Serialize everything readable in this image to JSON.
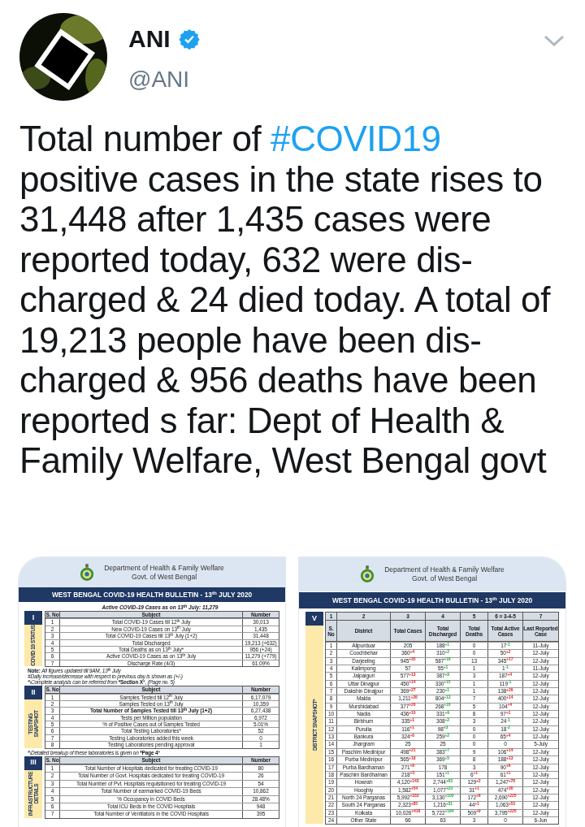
{
  "tweet": {
    "author": {
      "name": "ANI",
      "handle": "@ANI",
      "verified": true
    },
    "text": [
      {
        "kind": "text",
        "value": "Total number of "
      },
      {
        "kind": "hashtag",
        "value": "#COVID19"
      },
      {
        "kind": "text",
        "value": " positive cases in the state rises to 31,448 after 1,435 cases were reported today, 632 were dis-charged & 24 died today. A total of 19,213 people have been dis-charged & 956 deaths have been reported s far: Dept of Health & Family Welfare, West Bengal govt"
      }
    ]
  },
  "images": [
    {
      "kind": "status_sheet",
      "department": "Department of Health & Family Welfare",
      "government": "Govt. of West Bengal",
      "banner": "WEST BENGAL COVID-19 HEALTH BULLETIN -  13$^{th}$ JULY 2020",
      "headline": "Active COVID-19 Cases as on 13$^{th}$ July: 11,279",
      "sections": [
        {
          "numeral": "I",
          "label": "COVID 19 STATUS",
          "columns": [
            "S. No",
            "Subject",
            "Number"
          ],
          "rows": [
            [
              "1",
              "Total COVID-19 Cases till 12$^{th}$ July",
              "30,013"
            ],
            [
              "2",
              "New COVID-19 Cases on 13$^{th}$ July",
              "1,435"
            ],
            [
              "3",
              "Total COVID-19 Cases till 13$^{th}$ July (1+2)",
              "31,448"
            ],
            [
              "4",
              "Total Discharged",
              "19,213 (+632)"
            ],
            [
              "5",
              "Total Deaths as on 13$^{th}$ July*",
              "956 (+24)"
            ],
            [
              "6",
              "Active COVID-19 Cases as on 13$^{th}$ July",
              "11,279 (+779)"
            ],
            [
              "7",
              "Discharge Rate (4/3)",
              "61.09%"
            ]
          ],
          "notes": [
            "**Note:** *All figures updated till 9AM, 13$^{th}$ July*",
            "*#Daily increase/decrease with respect to previous day is shown as (+/-)*",
            "*\\*Complete analysis can be referred from* ***Section X***, *(Page no. 5)*"
          ]
        },
        {
          "numeral": "II",
          "label": "TESTING SNAPSHOT",
          "columns": [
            "S. No",
            "Subject",
            "Number"
          ],
          "rows": [
            [
              "1",
              "Samples Tested till 12$^{th}$ July",
              "6,17,079"
            ],
            [
              "2",
              "Samples Tested on 13$^{th}$ July",
              "10,359"
            ],
            [
              "3",
              "**Total Number of Samples Tested till 13$^{th}$ July (1+2)**",
              "6,27,438"
            ],
            [
              "4",
              "Tests per Million population",
              "6,972"
            ],
            [
              "5",
              "% of Positive Cases out of Samples Tested",
              "5.01%"
            ],
            [
              "6",
              "Total Testing Laboratories*",
              "52"
            ],
            [
              "7",
              "Testing Laboratories added this week",
              "0"
            ],
            [
              "8",
              "Testing Laboratories pending approval",
              "1"
            ]
          ],
          "notes": [
            "*\\*Detailed breakup of these laboratories is given on* ***Page 4***"
          ]
        },
        {
          "numeral": "III",
          "label": "INFRASTRUCTURE DETAILS",
          "columns": [
            "S. No",
            "Subject",
            "Number"
          ],
          "rows": [
            [
              "1",
              "Total Number of Hospitals dedicated for treating COVID-19",
              "80"
            ],
            [
              "2",
              "Total Number of Govt. Hospitals dedicated for treating COVID-19",
              "26"
            ],
            [
              "3",
              "Total Number of Pvt. Hospitals requisitioned for treating COVID-19",
              "54"
            ],
            [
              "4",
              "Total Number of earmarked COVID-19 Beds",
              "10,862"
            ],
            [
              "5",
              "% Occupancy in COVID Beds",
              "28.48%"
            ],
            [
              "6",
              "Total ICU Beds in the COVID Hospitals",
              "948"
            ],
            [
              "7",
              "Total Number of Ventilators in the COVID Hospitals",
              "395"
            ]
          ]
        }
      ]
    },
    {
      "kind": "district_sheet",
      "department": "Department of Health & Family Welfare",
      "government": "Govt. of West Bengal",
      "banner": "WEST BENGAL COVID-19 HEALTH BULLETIN -  13$^{th}$ JULY 2020",
      "section": {
        "numeral": "V",
        "label": "DISTRICT SNAPSHOT*",
        "column_numbers": [
          "1",
          "2",
          "3",
          "4",
          "5",
          "6 = 3-4-5",
          "7"
        ],
        "columns": [
          "S. No",
          "District",
          "Total Cases",
          "Total Discharged",
          "Total Deaths",
          "Total Active Cases",
          "Last Reported Case"
        ],
        "rows": [
          {
            "sno": "1",
            "district": "Alipurduar",
            "cases": "205",
            "cases_change": "",
            "discharged": "188",
            "discharged_change": "+1",
            "deaths": "0",
            "deaths_change": "",
            "active": "17",
            "active_change": "-1",
            "active_down": true,
            "last_case": "11-July"
          },
          {
            "sno": "2",
            "district": "Coochbehar",
            "cases": "360",
            "cases_change": "+4",
            "discharged": "310",
            "discharged_change": "+2",
            "deaths": "0",
            "deaths_change": "",
            "active": "50",
            "active_change": "+2",
            "active_down": false,
            "last_case": "12-July"
          },
          {
            "sno": "3",
            "district": "Darjeeling",
            "cases": "945",
            "cases_change": "+35",
            "discharged": "587",
            "discharged_change": "+18",
            "deaths": "13",
            "deaths_change": "",
            "active": "345",
            "active_change": "+17",
            "active_down": false,
            "last_case": "12-July"
          },
          {
            "sno": "4",
            "district": "Kalimpong",
            "cases": "57",
            "cases_change": "",
            "discharged": "55",
            "discharged_change": "+1",
            "deaths": "1",
            "deaths_change": "",
            "active": "1",
            "active_change": "-1",
            "active_down": true,
            "last_case": "11-July"
          },
          {
            "sno": "5",
            "district": "Jalpaiguri",
            "cases": "577",
            "cases_change": "+13",
            "discharged": "387",
            "discharged_change": "+9",
            "deaths": "3",
            "deaths_change": "",
            "active": "187",
            "active_change": "+4",
            "active_down": false,
            "last_case": "12-July"
          },
          {
            "sno": "6",
            "district": "Uttar Dinajpur",
            "cases": "450",
            "cases_change": "+14",
            "discharged": "330",
            "discharged_change": "+15",
            "deaths": "1",
            "deaths_change": "",
            "active": "119",
            "active_change": "-1",
            "active_down": true,
            "last_case": "12-July"
          },
          {
            "sno": "7",
            "district": "Dakshin Dinajpur",
            "cases": "369",
            "cases_change": "+27",
            "discharged": "230",
            "discharged_change": "+1",
            "deaths": "1",
            "deaths_change": "",
            "active": "138",
            "active_change": "+26",
            "active_down": false,
            "last_case": "12-July"
          },
          {
            "sno": "8",
            "district": "Malda",
            "cases": "1,211",
            "cases_change": "+26",
            "discharged": "804",
            "discharged_change": "+12",
            "deaths": "7",
            "deaths_change": "",
            "active": "400",
            "active_change": "+14",
            "active_down": false,
            "last_case": "12-July"
          },
          {
            "sno": "9",
            "district": "Murshidabad",
            "cases": "377",
            "cases_change": "+20",
            "discharged": "268",
            "discharged_change": "+16",
            "deaths": "5",
            "deaths_change": "",
            "active": "104",
            "active_change": "+4",
            "active_down": false,
            "last_case": "12-July"
          },
          {
            "sno": "10",
            "district": "Nadia",
            "cases": "436",
            "cases_change": "+10",
            "discharged": "331",
            "discharged_change": "+9",
            "deaths": "8",
            "deaths_change": "",
            "active": "97",
            "active_change": "+1",
            "active_down": false,
            "last_case": "12-July"
          },
          {
            "sno": "11",
            "district": "Birbhum",
            "cases": "335",
            "cases_change": "+1",
            "discharged": "308",
            "discharged_change": "+2",
            "deaths": "3",
            "deaths_change": "",
            "active": "24",
            "active_change": "-1",
            "active_down": true,
            "last_case": "12-July"
          },
          {
            "sno": "12",
            "district": "Purulia",
            "cases": "116",
            "cases_change": "+1",
            "discharged": "98",
            "discharged_change": "+3",
            "deaths": "0",
            "deaths_change": "",
            "active": "18",
            "active_change": "-2",
            "active_down": true,
            "last_case": "12-July"
          },
          {
            "sno": "13",
            "district": "Bankura",
            "cases": "324",
            "cases_change": "+6",
            "discharged": "259",
            "discharged_change": "+2",
            "deaths": "0",
            "deaths_change": "",
            "active": "65",
            "active_change": "+4",
            "active_down": false,
            "last_case": "12-July"
          },
          {
            "sno": "14",
            "district": "Jhargram",
            "cases": "25",
            "cases_change": "",
            "discharged": "25",
            "discharged_change": "",
            "deaths": "0",
            "deaths_change": "",
            "active": "0",
            "active_change": "",
            "last_case": "5-July"
          },
          {
            "sno": "15",
            "district": "Paschim Medinipur",
            "cases": "498",
            "cases_change": "+21",
            "discharged": "383",
            "discharged_change": "+7",
            "deaths": "9",
            "deaths_change": "",
            "active": "106",
            "active_change": "+14",
            "active_down": false,
            "last_case": "12-July"
          },
          {
            "sno": "16",
            "district": "Purba Medinipur",
            "cases": "565",
            "cases_change": "+18",
            "discharged": "369",
            "discharged_change": "+5",
            "deaths": "8",
            "deaths_change": "",
            "active": "188",
            "active_change": "+13",
            "active_down": false,
            "last_case": "12-July"
          },
          {
            "sno": "17",
            "district": "Purba Bardhaman",
            "cases": "271",
            "cases_change": "+8",
            "discharged": "178",
            "discharged_change": "",
            "deaths": "3",
            "deaths_change": "",
            "active": "90",
            "active_change": "+8",
            "active_down": false,
            "last_case": "12-July"
          },
          {
            "sno": "18",
            "district": "Paschim Bardhaman",
            "cases": "218",
            "cases_change": "+3",
            "discharged": "151",
            "discharged_change": "+1",
            "deaths": "6",
            "deaths_change": "+1",
            "active": "61",
            "active_change": "+1",
            "active_down": false,
            "last_case": "12-July"
          },
          {
            "sno": "19",
            "district": "Howrah",
            "cases": "4,120",
            "cases_change": "+143",
            "discharged": "2,744",
            "discharged_change": "+63",
            "deaths": "129",
            "deaths_change": "+2",
            "active": "1,247",
            "active_change": "+78",
            "active_down": false,
            "last_case": "12-July"
          },
          {
            "sno": "20",
            "district": "Hooghly",
            "cases": "1,582",
            "cases_change": "+54",
            "discharged": "1,077",
            "discharged_change": "+23",
            "deaths": "31",
            "deaths_change": "+1",
            "active": "474",
            "active_change": "+30",
            "active_down": false,
            "last_case": "12-July"
          },
          {
            "sno": "21",
            "district": "North 24 Parganas",
            "cases": "5,992",
            "cases_change": "+333",
            "discharged": "3,130",
            "discharged_change": "+100",
            "deaths": "172",
            "deaths_change": "+8",
            "active": "2,690",
            "active_change": "+225",
            "active_down": false,
            "last_case": "12-July"
          },
          {
            "sno": "22",
            "district": "South 24 Parganas",
            "cases": "2,323",
            "cases_change": "+85",
            "discharged": "1,216",
            "discharged_change": "+31",
            "deaths": "44",
            "deaths_change": "+1",
            "active": "1,063",
            "active_change": "+53",
            "active_down": false,
            "last_case": "12-July"
          },
          {
            "sno": "23",
            "district": "Kolkata",
            "cases": "10,026",
            "cases_change": "+418",
            "discharged": "5,722",
            "discharged_change": "+184",
            "deaths": "509",
            "deaths_change": "+9",
            "active": "3,795",
            "active_change": "+225",
            "active_down": false,
            "last_case": "12-July"
          },
          {
            "sno": "24",
            "district": "Other State",
            "cases": "66",
            "cases_change": "",
            "discharged": "63",
            "discharged_change": "",
            "deaths": "3",
            "deaths_change": "",
            "active": "0",
            "active_change": "",
            "last_case": "6-Jun"
          }
        ]
      }
    }
  ]
}
